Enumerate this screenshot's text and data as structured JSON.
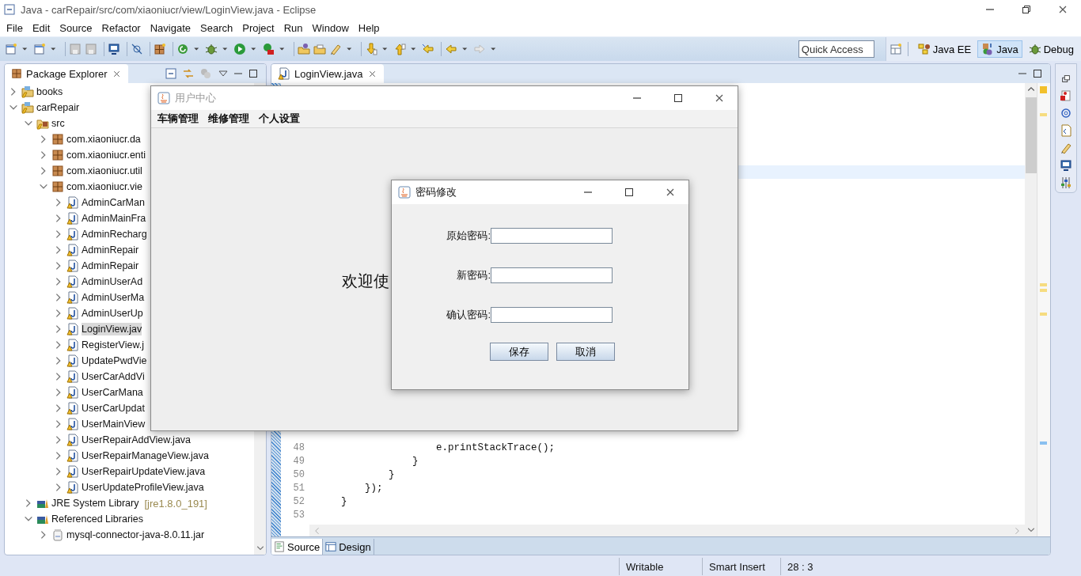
{
  "window": {
    "title": "Java - carRepair/src/com/xiaoniucr/view/LoginView.java - Eclipse"
  },
  "menu": [
    "File",
    "Edit",
    "Source",
    "Refactor",
    "Navigate",
    "Search",
    "Project",
    "Run",
    "Window",
    "Help"
  ],
  "toolbar": {
    "quick_access": {
      "placeholder": "Quick Access"
    },
    "perspectives": [
      {
        "label": "Java EE",
        "selected": false
      },
      {
        "label": "Java",
        "selected": true
      },
      {
        "label": "Debug",
        "selected": false
      }
    ]
  },
  "package_explorer": {
    "title": "Package Explorer",
    "tree": [
      {
        "label": "books",
        "kind": "project",
        "expanded": false,
        "selected": false
      },
      {
        "label": "carRepair",
        "kind": "project",
        "expanded": true,
        "selected": false,
        "children": [
          {
            "label": "src",
            "kind": "source-folder",
            "expanded": true,
            "selected": false,
            "children": [
              {
                "label": "com.xiaoniucr.da",
                "kind": "package",
                "expanded": false,
                "selected": false
              },
              {
                "label": "com.xiaoniucr.enti",
                "kind": "package",
                "expanded": false,
                "selected": false
              },
              {
                "label": "com.xiaoniucr.util",
                "kind": "package",
                "expanded": false,
                "selected": false
              },
              {
                "label": "com.xiaoniucr.vie",
                "kind": "package",
                "expanded": true,
                "selected": false,
                "children": [
                  {
                    "label": "AdminCarMan",
                    "kind": "java",
                    "expanded": false,
                    "selected": false
                  },
                  {
                    "label": "AdminMainFra",
                    "kind": "java",
                    "expanded": false,
                    "selected": false
                  },
                  {
                    "label": "AdminRecharg",
                    "kind": "java",
                    "expanded": false,
                    "selected": false
                  },
                  {
                    "label": "AdminRepair",
                    "kind": "java",
                    "expanded": false,
                    "selected": false
                  },
                  {
                    "label": "AdminRepair",
                    "kind": "java",
                    "expanded": false,
                    "selected": false
                  },
                  {
                    "label": "AdminUserAd",
                    "kind": "java",
                    "expanded": false,
                    "selected": false
                  },
                  {
                    "label": "AdminUserMa",
                    "kind": "java",
                    "expanded": false,
                    "selected": false
                  },
                  {
                    "label": "AdminUserUp",
                    "kind": "java",
                    "expanded": false,
                    "selected": false
                  },
                  {
                    "label": "LoginView.jav",
                    "kind": "java",
                    "expanded": false,
                    "selected": true
                  },
                  {
                    "label": "RegisterView.j",
                    "kind": "java",
                    "expanded": false,
                    "selected": false
                  },
                  {
                    "label": "UpdatePwdVie",
                    "kind": "java",
                    "expanded": false,
                    "selected": false
                  },
                  {
                    "label": "UserCarAddVi",
                    "kind": "java",
                    "expanded": false,
                    "selected": false
                  },
                  {
                    "label": "UserCarMana",
                    "kind": "java",
                    "expanded": false,
                    "selected": false
                  },
                  {
                    "label": "UserCarUpdat",
                    "kind": "java",
                    "expanded": false,
                    "selected": false
                  },
                  {
                    "label": "UserMainView",
                    "kind": "java",
                    "expanded": false,
                    "selected": false
                  },
                  {
                    "label": "UserRepairAddView.java",
                    "kind": "java",
                    "expanded": false,
                    "selected": false
                  },
                  {
                    "label": "UserRepairManageView.java",
                    "kind": "java",
                    "expanded": false,
                    "selected": false
                  },
                  {
                    "label": "UserRepairUpdateView.java",
                    "kind": "java",
                    "expanded": false,
                    "selected": false
                  },
                  {
                    "label": "UserUpdateProfileView.java",
                    "kind": "java",
                    "expanded": false,
                    "selected": false
                  }
                ]
              }
            ]
          },
          {
            "label": "JRE System Library",
            "suffix": "[jre1.8.0_191]",
            "kind": "library",
            "expanded": false,
            "selected": false
          },
          {
            "label": "Referenced Libraries",
            "kind": "library",
            "expanded": true,
            "selected": false,
            "children": [
              {
                "label": "mysql-connector-java-8.0.11.jar",
                "kind": "jar",
                "expanded": false,
                "selected": false
              }
            ]
          }
        ]
      }
    ]
  },
  "editor": {
    "tab": "LoginView.java",
    "lines": [
      {
        "number": "48",
        "code": "                    e.printStackTrace();"
      },
      {
        "number": "49",
        "code": "                }"
      },
      {
        "number": "50",
        "code": "            }"
      },
      {
        "number": "51",
        "code": "        });"
      },
      {
        "number": "52",
        "code": "    }"
      },
      {
        "number": "53"
      }
    ],
    "bottom_tabs": [
      {
        "label": "Source",
        "selected": true
      },
      {
        "label": "Design",
        "selected": false
      }
    ]
  },
  "status_bar": [
    "Writable",
    "Smart Insert",
    "28 : 3"
  ],
  "app_window": {
    "title": "用户中心",
    "menu": [
      "车辆管理",
      "维修管理",
      "个人设置"
    ],
    "welcome": "欢迎使"
  },
  "dialog": {
    "title": "密码修改",
    "fields": [
      {
        "label": "原始密码:"
      },
      {
        "label": "新密码:"
      },
      {
        "label": "确认密码:"
      }
    ],
    "buttons": [
      "保存",
      "取消"
    ]
  }
}
